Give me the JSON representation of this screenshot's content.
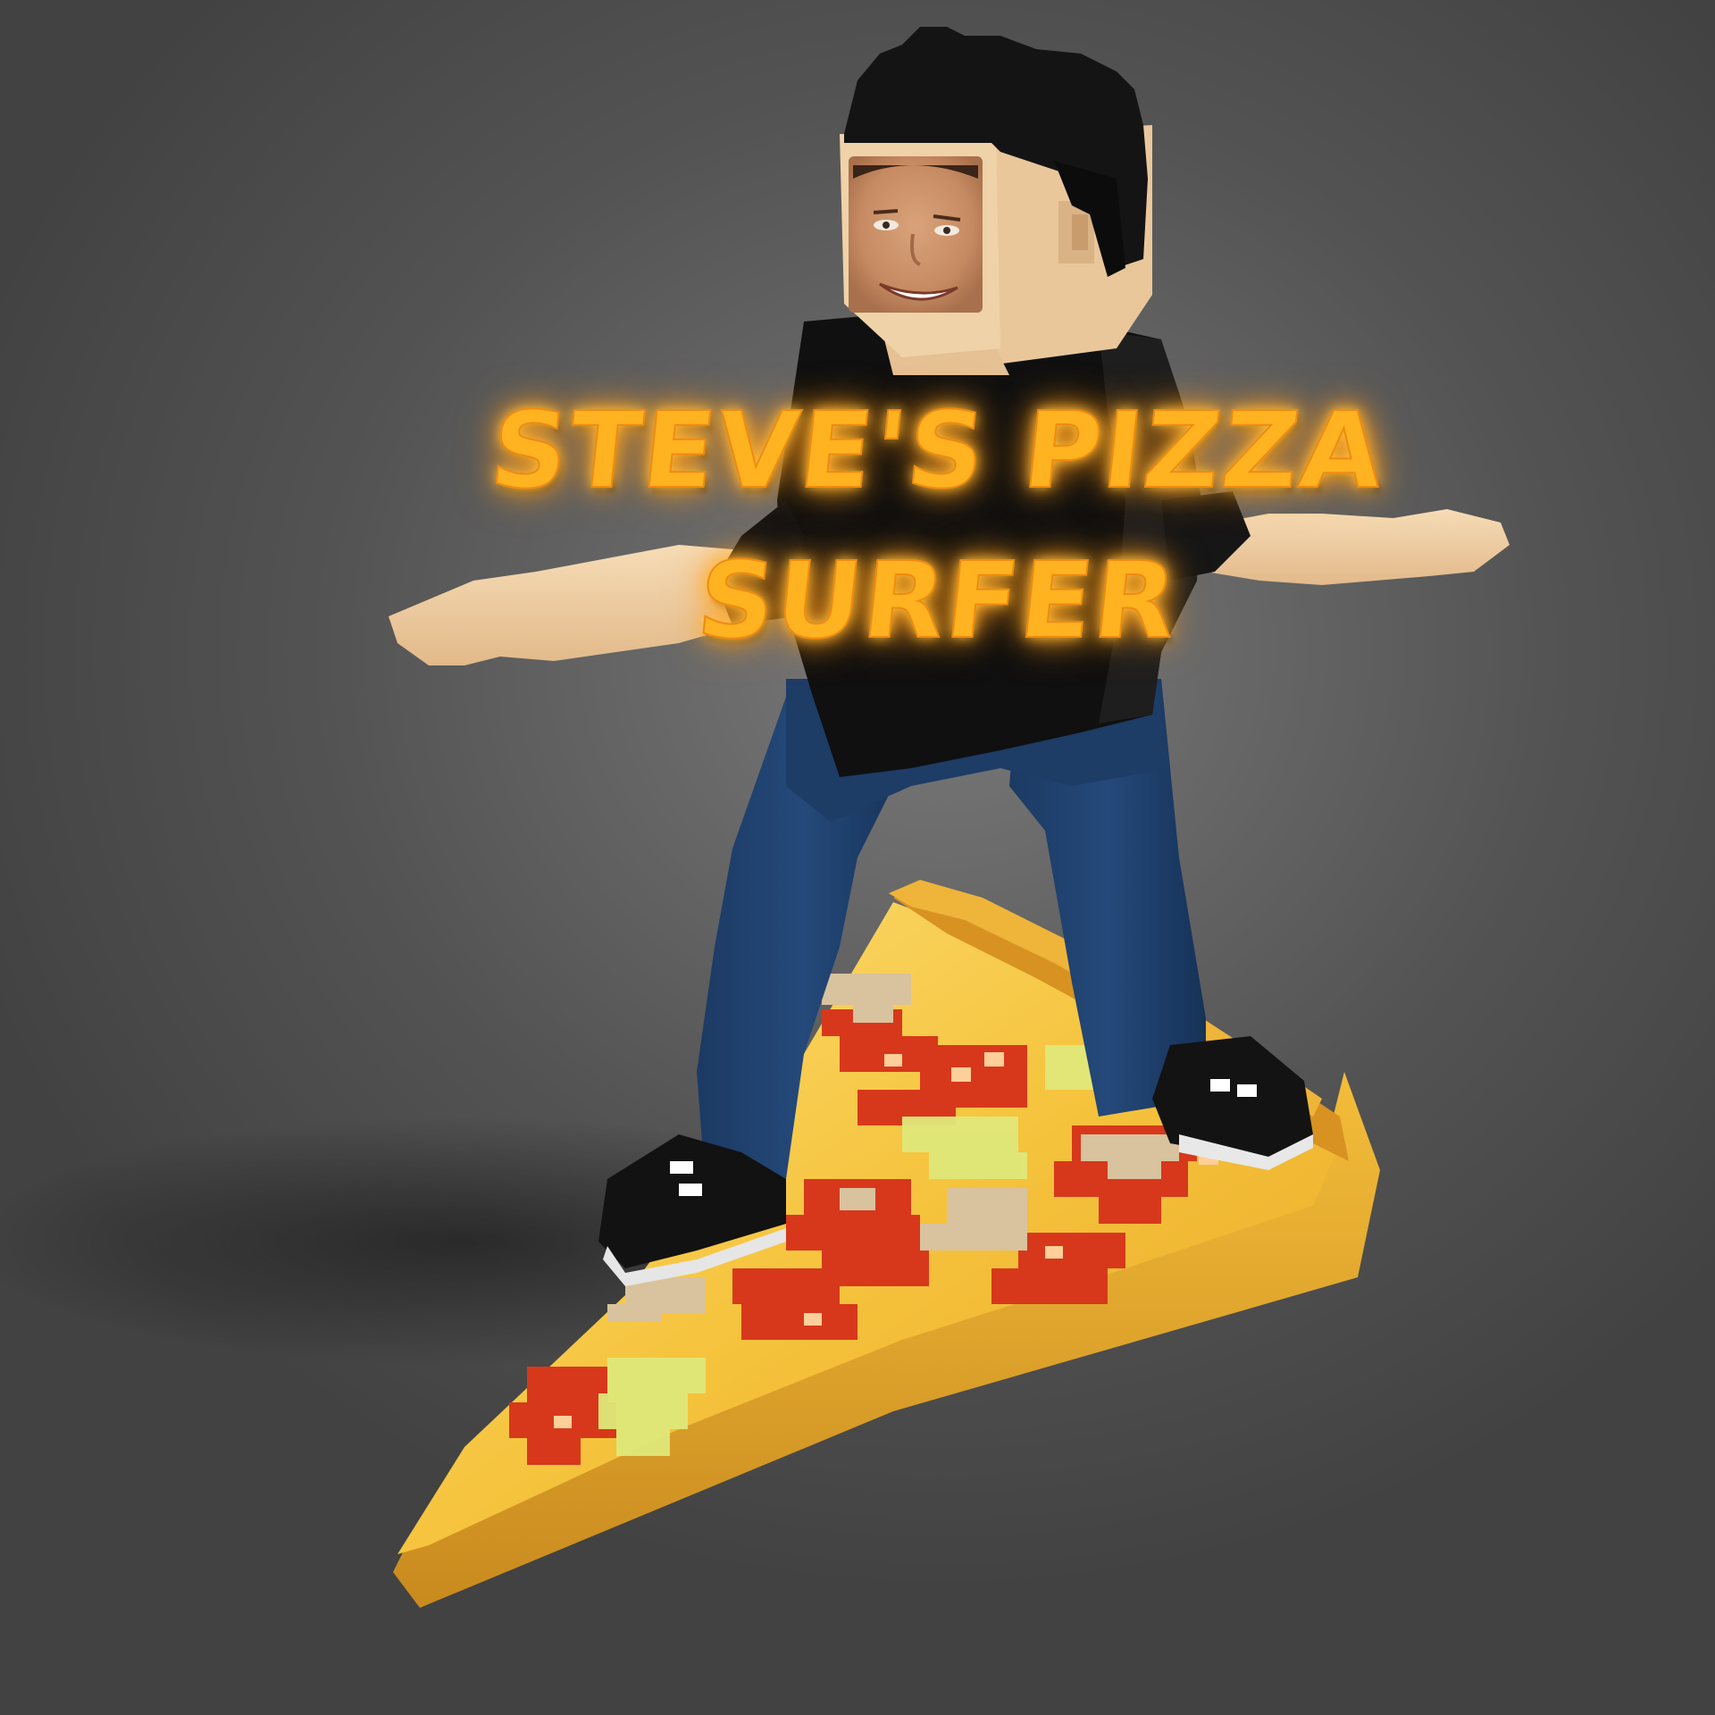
{
  "title": {
    "line1": "STEVE'S PIZZA",
    "line2": "SURFER"
  },
  "colors": {
    "background": "#595959",
    "title_glow": "#ffb320",
    "hair": "#151515",
    "skin": "#f2cfa4",
    "shirt": "#111111",
    "jeans": "#1e3d66",
    "shoe": "#111111",
    "crust": "#e0a030",
    "cheese": "#f5c03a",
    "pepperoni": "#d8381c",
    "mushroom": "#d8c2a0",
    "pepper": "#dde87a"
  },
  "scene": {
    "character": "voxel-surfer-character",
    "board": "pizza-slice-surfboard",
    "face": "photo-face"
  }
}
